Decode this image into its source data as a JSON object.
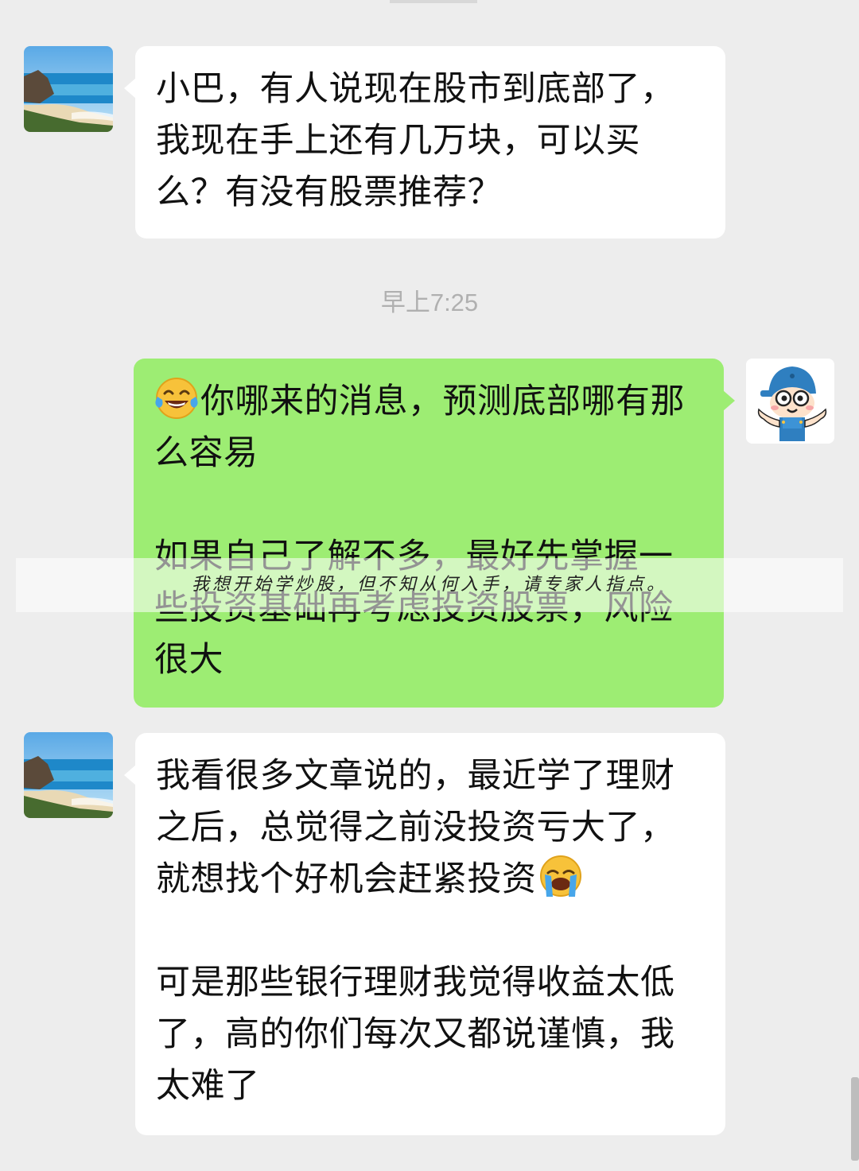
{
  "chat": {
    "messages": [
      {
        "sender": "user",
        "paragraphs": [
          "小巴，有人说现在股市到底部了，我现在手上还有几万块，可以买么？有没有股票推荐？"
        ]
      },
      {
        "type": "timestamp",
        "text": "早上7:25"
      },
      {
        "sender": "advisor",
        "paragraphs": [
          "你哪来的消息，预测底部哪有那么容易",
          "如果自己了解不多，最好先掌握一些投资基础再考虑投资股票，风险很大"
        ],
        "leading_emoji": "tears-of-joy-emoji"
      },
      {
        "sender": "user",
        "paragraphs": [
          "我看很多文章说的，最近学了理财之后，总觉得之前没投资亏大了，就想找个好机会赶紧投资",
          "可是那些银行理财我觉得收益太低了，高的你们每次又都说谨慎，我太难了"
        ],
        "trailing_emoji": "loudly-crying-face-emoji"
      }
    ]
  },
  "overlay": {
    "text": "我想开始学炒股，但不知从何入手，请专家人指点。"
  },
  "colors": {
    "background": "#ededed",
    "incoming_bubble": "#ffffff",
    "outgoing_bubble": "#9ded73",
    "timestamp": "#b0b0b0"
  }
}
